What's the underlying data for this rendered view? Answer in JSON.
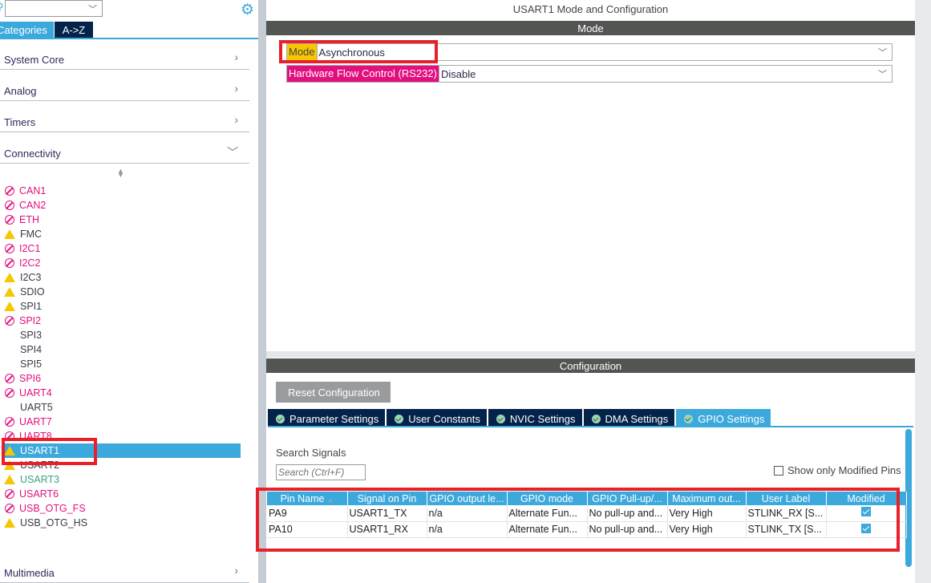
{
  "sidebar": {
    "search_value": "",
    "tabs": [
      "Categories",
      "A->Z"
    ],
    "categories": [
      "System Core",
      "Analog",
      "Timers",
      "Connectivity",
      "Multimedia"
    ],
    "items": [
      {
        "label": "CAN1",
        "status": "forbid"
      },
      {
        "label": "CAN2",
        "status": "forbid"
      },
      {
        "label": "ETH",
        "status": "forbid"
      },
      {
        "label": "FMC",
        "status": "warn"
      },
      {
        "label": "I2C1",
        "status": "forbid"
      },
      {
        "label": "I2C2",
        "status": "forbid"
      },
      {
        "label": "I2C3",
        "status": "warn"
      },
      {
        "label": "SDIO",
        "status": "warn"
      },
      {
        "label": "SPI1",
        "status": "warn"
      },
      {
        "label": "SPI2",
        "status": "forbid"
      },
      {
        "label": "SPI3",
        "status": "none"
      },
      {
        "label": "SPI4",
        "status": "none"
      },
      {
        "label": "SPI5",
        "status": "none"
      },
      {
        "label": "SPI6",
        "status": "forbid"
      },
      {
        "label": "UART4",
        "status": "forbid"
      },
      {
        "label": "UART5",
        "status": "none"
      },
      {
        "label": "UART7",
        "status": "forbid"
      },
      {
        "label": "UART8",
        "status": "forbid"
      },
      {
        "label": "USART1",
        "status": "warn",
        "selected": true
      },
      {
        "label": "USART2",
        "status": "warn"
      },
      {
        "label": "USART3",
        "status": "warn",
        "color": "green"
      },
      {
        "label": "USART6",
        "status": "forbid"
      },
      {
        "label": "USB_OTG_FS",
        "status": "forbid"
      },
      {
        "label": "USB_OTG_HS",
        "status": "warn"
      }
    ]
  },
  "main": {
    "title": "USART1 Mode and Configuration",
    "mode_header": "Mode",
    "mode_label": "Mode",
    "mode_value": "Asynchronous",
    "hfc_label": "Hardware Flow Control (RS232)",
    "hfc_value": "Disable",
    "config_header": "Configuration",
    "reset_label": "Reset Configuration",
    "tabs": [
      "Parameter Settings",
      "User Constants",
      "NVIC Settings",
      "DMA Settings",
      "GPIO Settings"
    ],
    "search_label": "Search Signals",
    "search_placeholder": "Search (Ctrl+F)",
    "show_modified_label": "Show only Modified Pins",
    "columns": [
      "Pin Name",
      "Signal on Pin",
      "GPIO output le...",
      "GPIO mode",
      "GPIO Pull-up/...",
      "Maximum out...",
      "User Label",
      "Modified"
    ],
    "rows": [
      [
        "PA9",
        "USART1_TX",
        "n/a",
        "Alternate Fun...",
        "No pull-up and...",
        "Very High",
        "STLINK_RX [S...",
        true
      ],
      [
        "PA10",
        "USART1_RX",
        "n/a",
        "Alternate Fun...",
        "No pull-up and...",
        "Very High",
        "STLINK_TX [S...",
        true
      ]
    ]
  },
  "colors": {
    "accent": "#3ca9dc",
    "navy": "#03234b",
    "pink": "#e2107f",
    "warn": "#f6c700",
    "annotation": "#e8202a"
  }
}
